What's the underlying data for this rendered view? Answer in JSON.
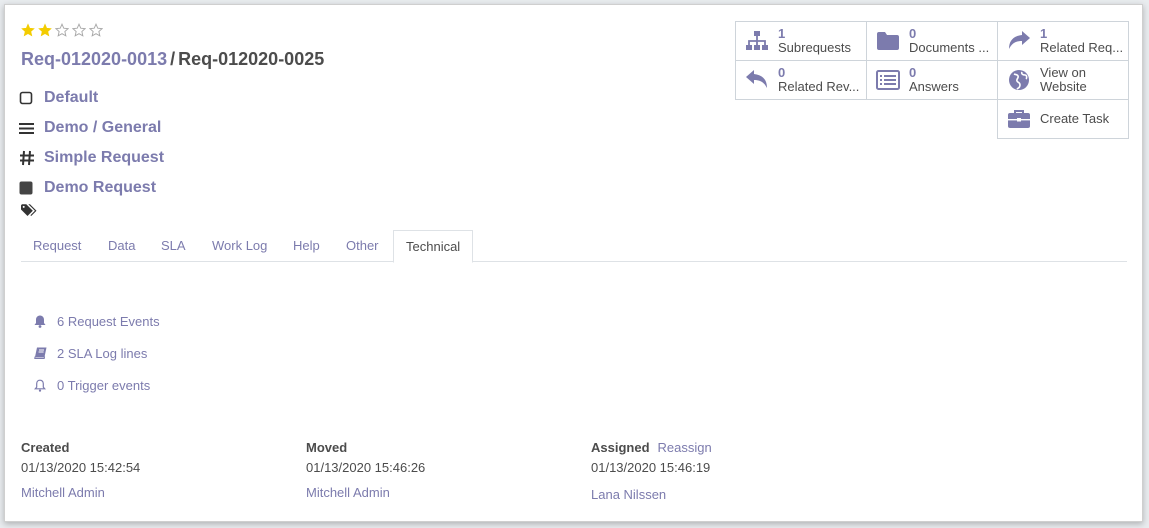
{
  "rating": {
    "value": 2,
    "max": 5,
    "filled_color": "#f3cc00",
    "empty_color": "#a8a8a8"
  },
  "title": {
    "parent": "Req-012020-0013",
    "separator": "/",
    "current": "Req-012020-0025"
  },
  "fields": {
    "priority": "Default",
    "category": "Demo / General",
    "type": "Simple Request",
    "kind": "Demo Request"
  },
  "stat_buttons": {
    "subrequests": {
      "count": "1",
      "label": "Subrequests",
      "icon": "sitemap-icon"
    },
    "documents": {
      "count": "0",
      "label": "Documents ...",
      "icon": "folder-icon"
    },
    "related_requests": {
      "count": "1",
      "label": "Related Req...",
      "icon": "share-icon"
    },
    "related_reverse": {
      "count": "0",
      "label": "Related Rev...",
      "icon": "reply-icon"
    },
    "answers": {
      "count": "0",
      "label": "Answers",
      "icon": "list-alt-icon"
    },
    "view_website": {
      "line1": "View on",
      "line2": "Website",
      "icon": "globe-icon"
    },
    "create_task": {
      "label": "Create Task",
      "icon": "briefcase-icon"
    }
  },
  "tabs": [
    "Request",
    "Data",
    "SLA",
    "Work Log",
    "Help",
    "Other",
    "Technical"
  ],
  "active_tab": "Technical",
  "technical": {
    "events": "6 Request Events",
    "sla_log": "2 SLA Log lines",
    "triggers": "0 Trigger events"
  },
  "footer": {
    "created": {
      "label": "Created",
      "date": "01/13/2020 15:42:54",
      "user": "Mitchell Admin"
    },
    "moved": {
      "label": "Moved",
      "date": "01/13/2020 15:46:26",
      "user": "Mitchell Admin"
    },
    "assigned": {
      "label": "Assigned",
      "action": "Reassign",
      "date": "01/13/2020 15:46:19",
      "user": "Lana Nilssen"
    }
  },
  "colors": {
    "accent": "#7c7bad",
    "text": "#4c4c4c",
    "border": "#ced4da",
    "icon_dark": "#4c4c4c"
  }
}
